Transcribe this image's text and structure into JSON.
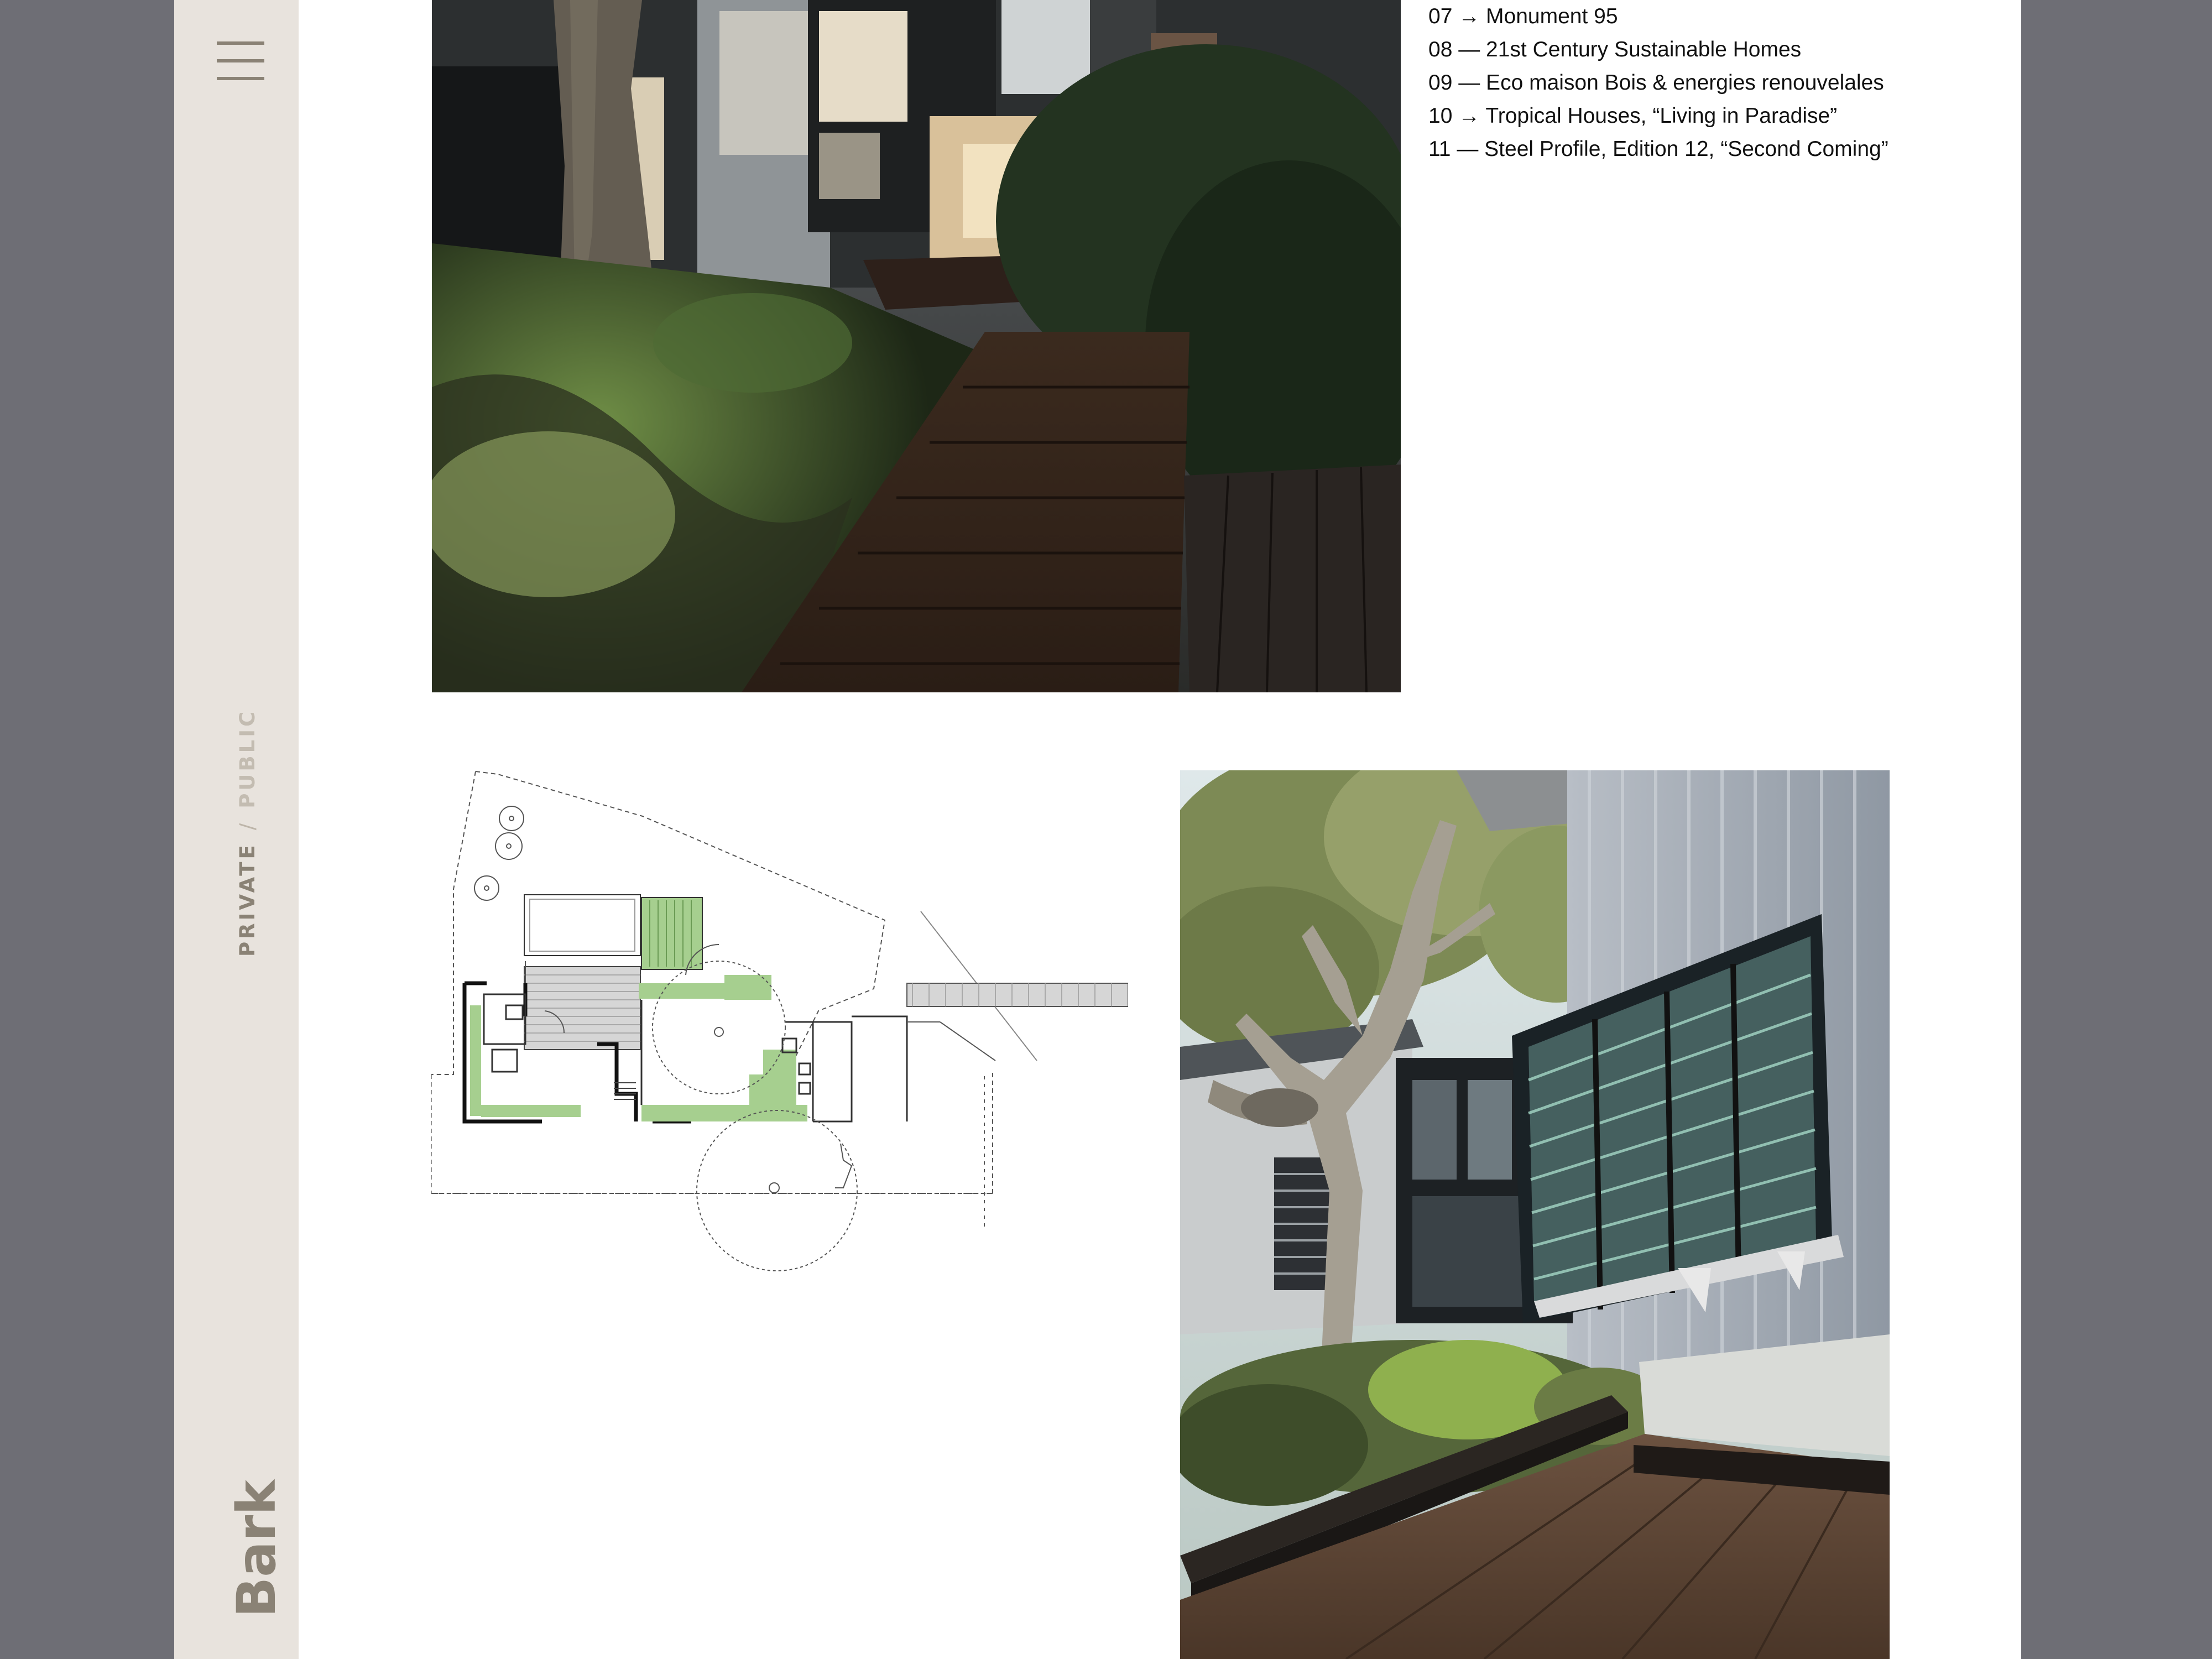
{
  "colors": {
    "outer_background": "#6e6e75",
    "page_background": "#ffffff",
    "sidebar_background": "#e8e3dd",
    "sidebar_text": "#8a8275",
    "inactive_nav_text": "#c3bcb1",
    "plan_highlight": "#a6cf8f"
  },
  "sidebar": {
    "menu_icon": "hamburger-icon",
    "nav": {
      "private": "PRIVATE",
      "separator": "/",
      "public": "PUBLIC",
      "active": "PRIVATE"
    },
    "brand": "Bark"
  },
  "publications": [
    "07 → Monument 95",
    "08 — 21st Century Sustainable Homes",
    "09 — Eco maison Bois & energies renouvelales",
    "10 → Tropical Houses, “Living in Paradise”",
    "11 — Steel Profile, Edition 12, “Second Coming”"
  ],
  "images": {
    "photo_1": "night-garden-boardwalk-photo",
    "floor_plan": "site-floor-plan-drawing",
    "north_arrow": "north-arrow-icon",
    "photo_2": "courtyard-tree-louvres-photo"
  }
}
